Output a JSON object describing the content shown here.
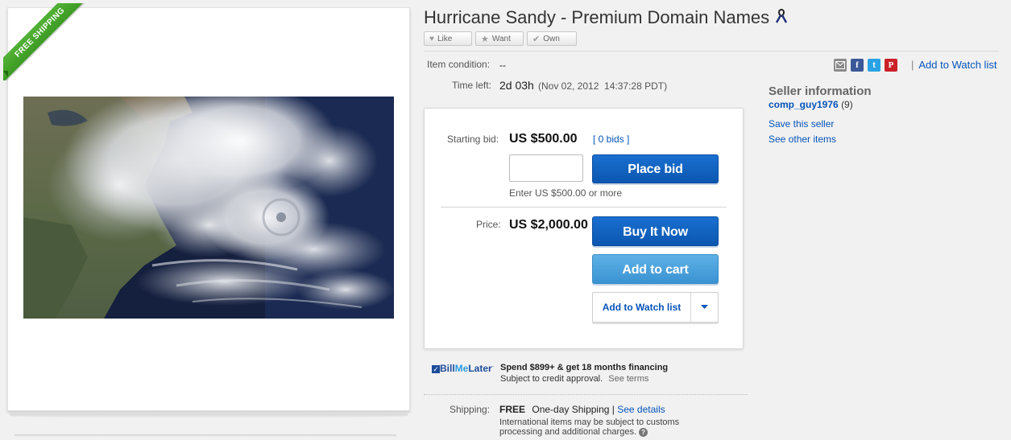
{
  "listing": {
    "title": "Hurricane Sandy - Premium Domain Names",
    "free_shipping_ribbon": "FREE SHIPPING",
    "social": {
      "like": "Like",
      "want": "Want",
      "own": "Own"
    },
    "condition_label": "Item condition:",
    "condition_value": "--",
    "time_left_label": "Time left:",
    "time_left_value": "2d 03h",
    "time_left_date": "(Nov 02, 2012  14:37:28 PDT)",
    "share": {
      "icons": [
        "email-icon",
        "facebook-icon",
        "twitter-icon",
        "pinterest-icon"
      ],
      "watch_link": "Add to Watch list"
    }
  },
  "bid_box": {
    "starting_bid_label": "Starting bid:",
    "starting_bid_value": "US $500.00",
    "bids_link": "[ 0 bids ]",
    "bid_input_value": "",
    "place_bid": "Place bid",
    "bid_hint": "Enter US $500.00 or more",
    "price_label": "Price:",
    "price_value": "US $2,000.00",
    "buy_it_now": "Buy It Now",
    "add_to_cart": "Add to cart",
    "add_to_watch": "Add to Watch list"
  },
  "financing": {
    "logo_bill": "Bill",
    "logo_me": "Me",
    "logo_later": "Later",
    "logo_mark": "·",
    "headline": "Spend $899+ & get 18 months financing",
    "subtext": "Subject to credit approval.",
    "see_terms": "See terms"
  },
  "shipping": {
    "label": "Shipping:",
    "cost": "FREE",
    "method": "One-day Shipping",
    "details_sep": "|",
    "details_link": "See details",
    "note_line1": "International items may be subject to customs",
    "note_line2": "processing and additional charges."
  },
  "seller": {
    "heading": "Seller information",
    "username": "comp_guy1976",
    "feedback": "(9)",
    "save_seller": "Save this seller",
    "see_other": "See other items"
  },
  "colors": {
    "link": "#0654ba",
    "primary_button": "#0b57b0",
    "secondary_button": "#3a93d2",
    "ribbon_green": "#46a52a"
  }
}
